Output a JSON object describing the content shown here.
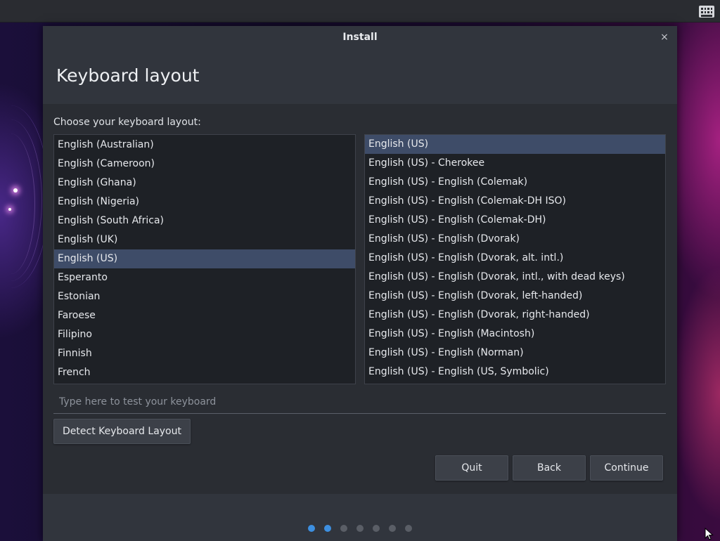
{
  "window": {
    "title": "Install",
    "close_glyph": "×"
  },
  "page": {
    "title": "Keyboard layout",
    "prompt": "Choose your keyboard layout:"
  },
  "layouts": [
    {
      "label": "English (Australian)",
      "selected": false
    },
    {
      "label": "English (Cameroon)",
      "selected": false
    },
    {
      "label": "English (Ghana)",
      "selected": false
    },
    {
      "label": "English (Nigeria)",
      "selected": false
    },
    {
      "label": "English (South Africa)",
      "selected": false
    },
    {
      "label": "English (UK)",
      "selected": false
    },
    {
      "label": "English (US)",
      "selected": true
    },
    {
      "label": "Esperanto",
      "selected": false
    },
    {
      "label": "Estonian",
      "selected": false
    },
    {
      "label": "Faroese",
      "selected": false
    },
    {
      "label": "Filipino",
      "selected": false
    },
    {
      "label": "Finnish",
      "selected": false
    },
    {
      "label": "French",
      "selected": false
    }
  ],
  "variants": [
    {
      "label": "English (US)",
      "selected": true
    },
    {
      "label": "English (US) - Cherokee",
      "selected": false
    },
    {
      "label": "English (US) - English (Colemak)",
      "selected": false
    },
    {
      "label": "English (US) - English (Colemak-DH ISO)",
      "selected": false
    },
    {
      "label": "English (US) - English (Colemak-DH)",
      "selected": false
    },
    {
      "label": "English (US) - English (Dvorak)",
      "selected": false
    },
    {
      "label": "English (US) - English (Dvorak, alt. intl.)",
      "selected": false
    },
    {
      "label": "English (US) - English (Dvorak, intl., with dead keys)",
      "selected": false
    },
    {
      "label": "English (US) - English (Dvorak, left-handed)",
      "selected": false
    },
    {
      "label": "English (US) - English (Dvorak, right-handed)",
      "selected": false
    },
    {
      "label": "English (US) - English (Macintosh)",
      "selected": false
    },
    {
      "label": "English (US) - English (Norman)",
      "selected": false
    },
    {
      "label": "English (US) - English (US, Symbolic)",
      "selected": false
    }
  ],
  "test_input": {
    "value": "",
    "placeholder": "Type here to test your keyboard"
  },
  "buttons": {
    "detect": "Detect Keyboard Layout",
    "quit": "Quit",
    "back": "Back",
    "continue": "Continue"
  },
  "progress": {
    "total_steps": 7,
    "current_step": 2
  },
  "colors": {
    "selection": "#3e4c68",
    "accent": "#3d8fe0",
    "window_bg": "#2a2d33"
  },
  "icons": {
    "tray": "keyboard-icon",
    "close": "close-icon",
    "pointer": "mouse-pointer-icon"
  }
}
